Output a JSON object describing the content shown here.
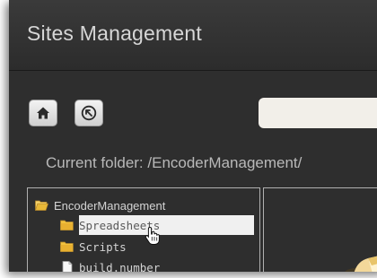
{
  "window": {
    "title": "Sites Management"
  },
  "toolbar": {
    "home_icon": "home-icon",
    "back_icon": "back-arrow-icon",
    "search": {
      "value": "",
      "placeholder": ""
    }
  },
  "current_folder": {
    "text": "Current folder: /EncoderManagement/"
  },
  "tree": {
    "items": [
      {
        "label": "EncoderManagement",
        "icon": "folder-open-icon"
      },
      {
        "label": "Spreadsheets",
        "icon": "folder-icon",
        "selected": true
      },
      {
        "label": "Scripts",
        "icon": "folder-icon"
      },
      {
        "label": "build.number",
        "icon": "file-icon"
      }
    ]
  },
  "colors": {
    "background": "#2e2e2e",
    "title_text": "#d6d6d6",
    "folder": "#e8b838",
    "selection": "#f0f0f0"
  }
}
